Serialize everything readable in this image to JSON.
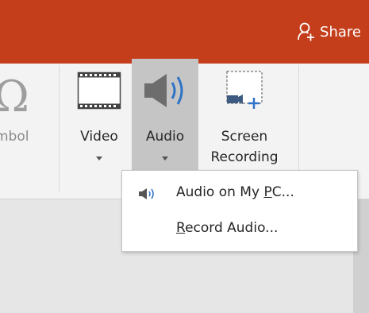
{
  "title_bar": {
    "share_label": "Share",
    "background_color": "#c43e1c",
    "share_icon": "person-add-icon"
  },
  "ribbon": {
    "symbol": {
      "label": "mbol",
      "glyph": "Ω",
      "icon": "omega-symbol-icon"
    },
    "video": {
      "label": "Video",
      "icon": "film-strip-icon"
    },
    "audio": {
      "label": "Audio",
      "icon": "speaker-icon",
      "state": "pressed"
    },
    "screen_recording": {
      "label_line1": "Screen",
      "label_line2": "Recording",
      "icon": "screen-recording-icon"
    }
  },
  "audio_menu": {
    "items": [
      {
        "label_before": "Audio on My ",
        "label_accel": "P",
        "label_after": "C...",
        "icon": "speaker-icon"
      },
      {
        "label_before": "",
        "label_accel": "R",
        "label_after": "ecord Audio...",
        "icon": ""
      }
    ]
  }
}
